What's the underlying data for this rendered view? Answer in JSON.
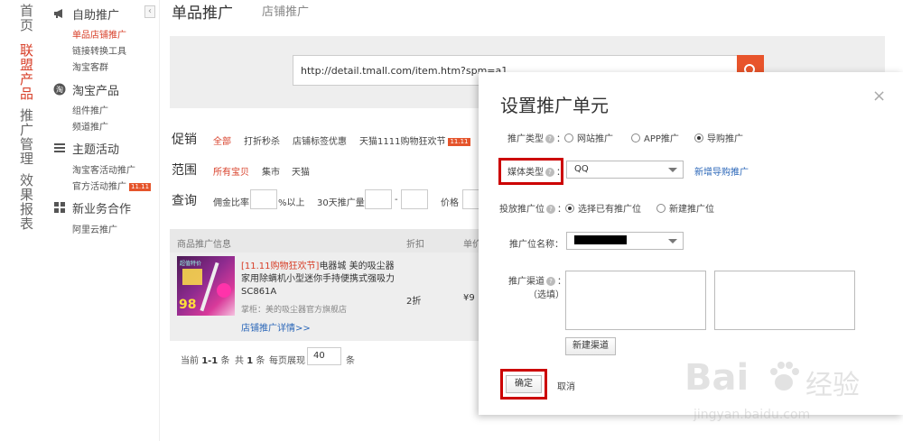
{
  "primary_nav": [
    {
      "label": "首页",
      "active": false
    },
    {
      "label": "联盟产品",
      "active": true
    },
    {
      "label": "推广管理",
      "active": false
    },
    {
      "label": "效果报表",
      "active": false
    }
  ],
  "sub_nav": {
    "groups": [
      {
        "title": "自助推广",
        "icon": "megaphone-icon",
        "items": [
          "单品店铺推广",
          "链接转换工具",
          "淘宝客群"
        ]
      },
      {
        "title": "淘宝产品",
        "icon": "taobao-icon",
        "items": [
          "组件推广",
          "频道推广"
        ]
      },
      {
        "title": "主题活动",
        "icon": "list-icon",
        "items": [
          "淘宝客活动推广",
          "官方活动推广"
        ]
      },
      {
        "title": "新业务合作",
        "icon": "grid-icon",
        "items": [
          "阿里云推广"
        ]
      }
    ],
    "active_item": "单品店铺推广",
    "badge": "11.11",
    "collapse": "‹"
  },
  "tabs": {
    "main": "单品推广",
    "sub": "店铺推广"
  },
  "search": {
    "value": "http://detail.tmall.com/item.htm?spm=a1"
  },
  "filters": {
    "promo_label": "促销",
    "promo_options": [
      "全部",
      "打折秒杀",
      "店铺标签优惠",
      "天猫1111购物狂欢节"
    ],
    "range_label": "范围",
    "range_options": [
      "所有宝贝",
      "集市",
      "天猫"
    ],
    "query_label": "查询",
    "commission": "佣金比率",
    "commission_suffix": "%以上",
    "volume": "30天推广量",
    "dash": "-",
    "price": "价格",
    "badge": "11.11"
  },
  "table": {
    "headers": [
      "商品推广信息",
      "折扣",
      "单价"
    ],
    "row": {
      "promo_tag": "[11.11购物狂欢节]",
      "title": "电器城 美的吸尘器家用除螨机小型迷你手持便携式强吸力",
      "code": "SC861A",
      "seller": "掌柜：美的吸尘器官方旗舰店",
      "detail_link": "店铺推广详情>>",
      "discount": "2折",
      "price": "¥9",
      "thumb_top": "超值特价",
      "thumb_price": "98"
    }
  },
  "pager": {
    "current_prefix": "当前",
    "current": "1-1",
    "current_suffix": "条",
    "total_prefix": "共",
    "total": "1",
    "total_suffix": "条",
    "per_page": "每页展现",
    "per_page_value": "40",
    "per_page_suffix": "条"
  },
  "modal": {
    "title": "设置推广单元",
    "close": "×",
    "promo_type_label": "推广类型",
    "promo_type_options": [
      {
        "label": "网站推广",
        "checked": false
      },
      {
        "label": "APP推广",
        "checked": false
      },
      {
        "label": "导购推广",
        "checked": true
      }
    ],
    "media_type_label": "媒体类型",
    "media_type_value": "QQ",
    "new_media_link": "新增导购推广",
    "slot_label": "投放推广位",
    "slot_options": [
      {
        "label": "选择已有推广位",
        "checked": true
      },
      {
        "label": "新建推广位",
        "checked": false
      }
    ],
    "slot_name_label": "推广位名称",
    "channel_label": "推广渠道",
    "channel_optional": "（选填）",
    "new_channel_button": "新建渠道",
    "confirm_button": "确定",
    "cancel_button": "取消",
    "colon": "："
  },
  "watermark": {
    "brand": "Bai",
    "brand2": "经验",
    "url": "jingyan.baidu.com"
  },
  "colors": {
    "accent": "#d8402a",
    "search_button": "#e8542b",
    "link": "#2a66b8",
    "highlight_box": "#cc0000"
  }
}
